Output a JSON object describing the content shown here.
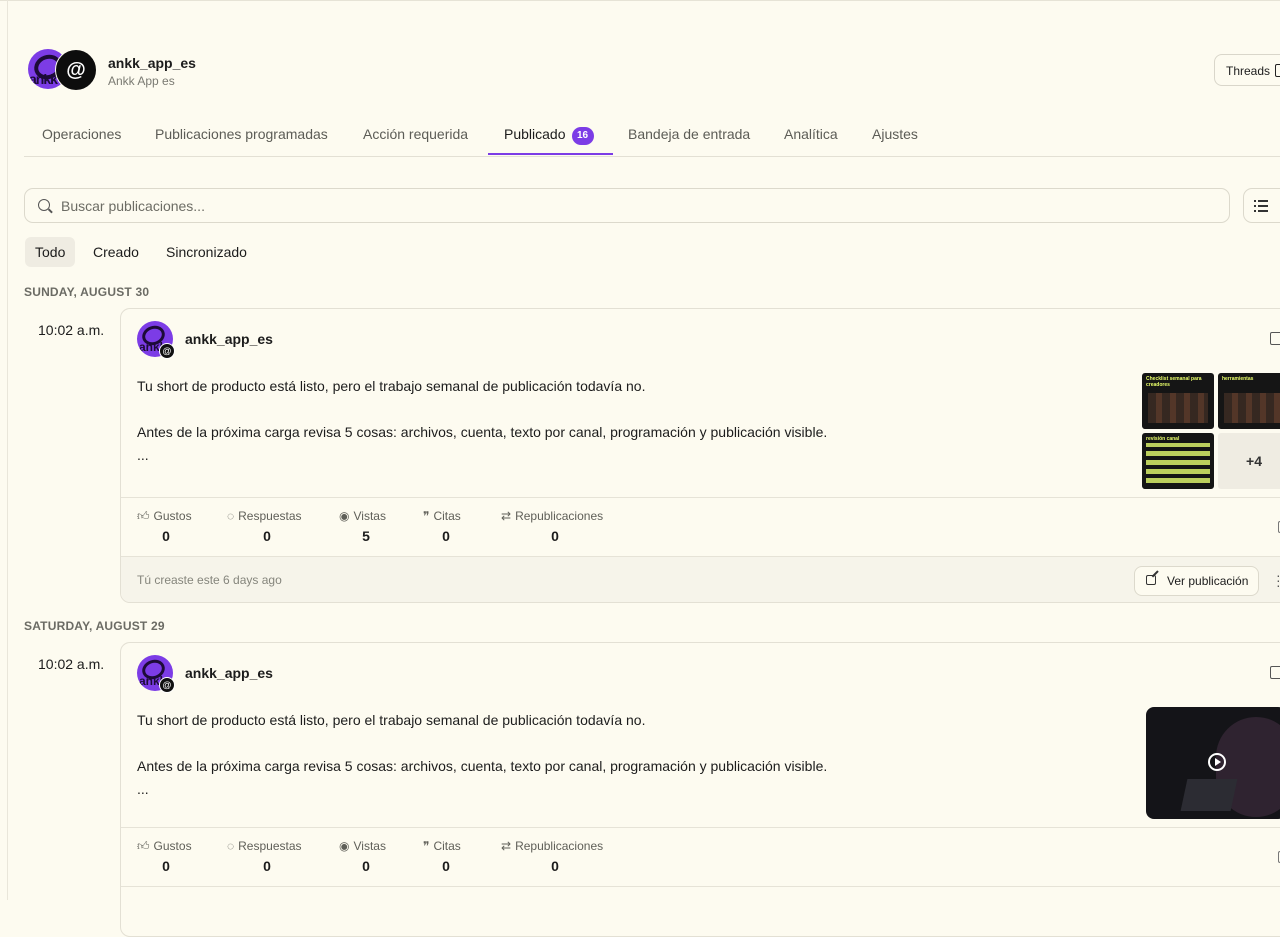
{
  "account": {
    "handle": "ankk_app_es",
    "display_name": "Ankk App es",
    "brand_avatar_text": "ankk",
    "platform_glyph": "@"
  },
  "platform_button": {
    "label": "Threads"
  },
  "tabs": [
    {
      "label": "Operaciones"
    },
    {
      "label": "Publicaciones programadas"
    },
    {
      "label": "Acción requerida"
    },
    {
      "label": "Publicado",
      "badge": "16",
      "active": true
    },
    {
      "label": "Bandeja de entrada"
    },
    {
      "label": "Analítica"
    },
    {
      "label": "Ajustes"
    }
  ],
  "search": {
    "placeholder": "Buscar publicaciones..."
  },
  "filters": [
    {
      "label": "Todo",
      "active": true
    },
    {
      "label": "Creado"
    },
    {
      "label": "Sincronizado"
    }
  ],
  "stat_labels": {
    "likes": "Gustos",
    "replies": "Respuestas",
    "views": "Vistas",
    "quotes": "Citas",
    "reposts": "Republicaciones"
  },
  "posts": [
    {
      "day": "SUNDAY, AUGUST 30",
      "time": "10:02 a.m.",
      "author": "ankk_app_es",
      "line1": "Tu short de producto está listo, pero el trabajo semanal de publicación todavía no.",
      "line2": "Antes de la próxima carga revisa 5 cosas: archivos, cuenta, texto por canal, programación y publicación visible.",
      "ellipsis": "...",
      "stats": {
        "likes": "0",
        "replies": "0",
        "views": "5",
        "quotes": "0",
        "reposts": "0"
      },
      "media_more": "+4",
      "footer_text": "Tú creaste este 6 days ago",
      "view_label": "Ver publicación"
    },
    {
      "day": "SATURDAY, AUGUST 29",
      "time": "10:02 a.m.",
      "author": "ankk_app_es",
      "line1": "Tu short de producto está listo, pero el trabajo semanal de publicación todavía no.",
      "line2": "Antes de la próxima carga revisa 5 cosas: archivos, cuenta, texto por canal, programación y publicación visible.",
      "ellipsis": "...",
      "stats": {
        "likes": "0",
        "replies": "0",
        "views": "0",
        "quotes": "0",
        "reposts": "0"
      }
    }
  ],
  "colors": {
    "accent": "#7c3ce6",
    "background": "#fdfbf0"
  }
}
